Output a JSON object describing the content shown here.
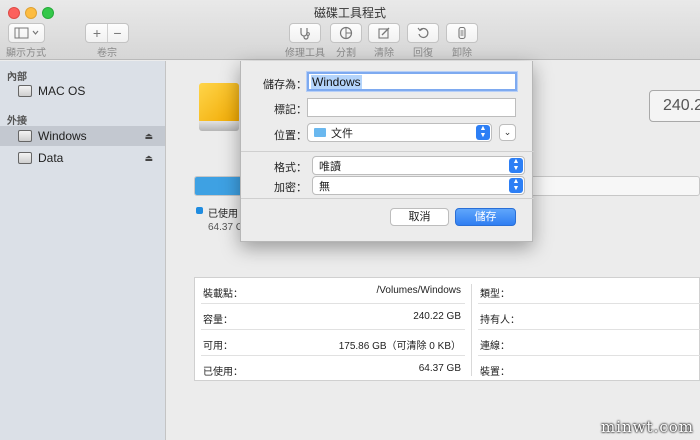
{
  "window": {
    "title": "磁碟工具程式"
  },
  "toolbar": {
    "view_label": "顯示方式",
    "volume_label": "卷宗",
    "add_symbol": "+",
    "remove_symbol": "−",
    "actions": [
      {
        "label": "修理工具",
        "icon": "stethoscope-icon"
      },
      {
        "label": "分割",
        "icon": "partition-icon"
      },
      {
        "label": "清除",
        "icon": "erase-icon"
      },
      {
        "label": "回復",
        "icon": "restore-icon"
      },
      {
        "label": "卸除",
        "icon": "unmount-icon"
      }
    ]
  },
  "sidebar": {
    "section_internal": "內部",
    "section_external": "外接",
    "items": [
      {
        "label": "MAC OS"
      },
      {
        "label": "Windows"
      },
      {
        "label": "Data"
      }
    ],
    "eject_symbol": "⏏"
  },
  "main": {
    "capacity_text": "240.2",
    "used_label": "已使用",
    "used_size": "64.37 G",
    "used_fraction": 0.268,
    "accent_color": "#3ea1e3"
  },
  "info": {
    "rows": [
      {
        "key": "裝載點：",
        "value": "/Volumes/Windows",
        "key2": "類型："
      },
      {
        "key": "容量：",
        "value": "240.22 GB",
        "key2": "持有人："
      },
      {
        "key": "可用：",
        "value": "175.86 GB（可清除 0 KB）",
        "key2": "連線："
      },
      {
        "key": "已使用：",
        "value": "64.37 GB",
        "key2": "裝置："
      }
    ]
  },
  "dialog": {
    "save_as_label": "儲存為：",
    "save_as_value": "Windows",
    "tags_label": "標記：",
    "tags_value": "",
    "where_label": "位置：",
    "where_value": "文件",
    "format_label": "格式：",
    "format_value": "唯讀",
    "encryption_label": "加密：",
    "encryption_value": "無",
    "cancel_label": "取消",
    "save_label": "儲存",
    "popup_arrow_up": "▲",
    "popup_arrow_down": "▼",
    "expand_symbol": "⌄"
  },
  "watermark": {
    "text": "minwt.com"
  }
}
